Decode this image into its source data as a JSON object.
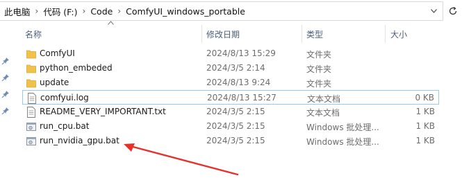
{
  "address_bar": {
    "crumbs": [
      "此电脑",
      "代码 (F:)",
      "Code",
      "ComfyUI_windows_portable"
    ]
  },
  "columns": {
    "name": "名称",
    "date": "修改日期",
    "type": "类型",
    "size": "大小"
  },
  "files": [
    {
      "name": "ComfyUI",
      "date": "2024/8/13 15:29",
      "type": "文件夹",
      "size": "",
      "icon": "folder-icon"
    },
    {
      "name": "python_embeded",
      "date": "2024/3/5 2:14",
      "type": "文件夹",
      "size": "",
      "icon": "folder-icon"
    },
    {
      "name": "update",
      "date": "2024/8/13 9:24",
      "type": "文件夹",
      "size": "",
      "icon": "folder-icon"
    },
    {
      "name": "comfyui.log",
      "date": "2024/8/13 15:27",
      "type": "文本文档",
      "size": "0 KB",
      "icon": "text-file-icon"
    },
    {
      "name": "README_VERY_IMPORTANT.txt",
      "date": "2024/3/5 2:15",
      "type": "文本文档",
      "size": "1 KB",
      "icon": "text-file-icon"
    },
    {
      "name": "run_cpu.bat",
      "date": "2024/3/5 2:15",
      "type": "Windows 批处理...",
      "size": "1 KB",
      "icon": "batch-file-icon"
    },
    {
      "name": "run_nvidia_gpu.bat",
      "date": "2024/3/5 2:15",
      "type": "Windows 批处理...",
      "size": "1 KB",
      "icon": "batch-file-icon"
    }
  ],
  "colors": {
    "folder": "#f0c14b",
    "header_text": "#4c607a",
    "selection_border": "#99c9ef",
    "annotation_arrow": "#e8302a"
  }
}
